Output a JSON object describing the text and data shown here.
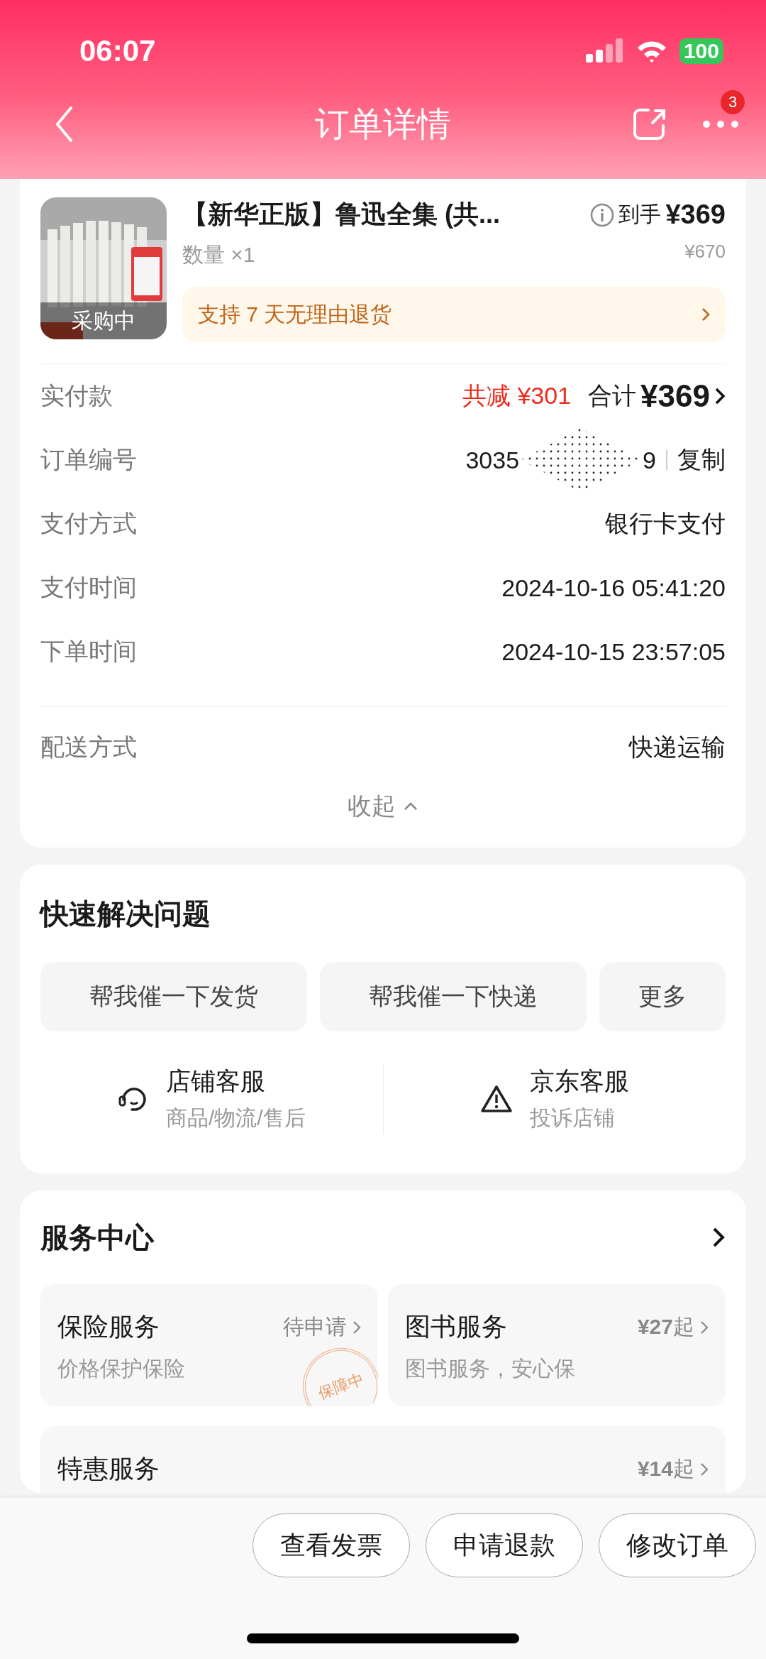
{
  "status_bar": {
    "time": "06:07",
    "battery": "100"
  },
  "nav": {
    "title": "订单详情",
    "badge": "3"
  },
  "product": {
    "title": "【新华正版】鲁迅全集 (共...",
    "image_label": "采购中",
    "final_price_label": "到手",
    "final_price": "¥369",
    "quantity_label": "数量",
    "quantity": "×1",
    "original_price": "¥670",
    "return_policy": "支持 7 天无理由退货"
  },
  "payment": {
    "label": "实付款",
    "discount": "共减 ¥301",
    "total_label": "合计",
    "total": "¥369"
  },
  "details": [
    {
      "label": "订单编号",
      "kind": "order_number",
      "value_start": "3035",
      "value_end": "9",
      "action": "复制"
    },
    {
      "label": "支付方式",
      "kind": "text",
      "value": "银行卡支付"
    },
    {
      "label": "支付时间",
      "kind": "text",
      "value": "2024-10-16 05:41:20"
    },
    {
      "label": "下单时间",
      "kind": "text",
      "value": "2024-10-15 23:57:05"
    }
  ],
  "shipping": {
    "label": "配送方式",
    "value": "快递运输"
  },
  "collapse": "收起",
  "quick_help": {
    "title": "快速解决问题",
    "actions": [
      "帮我催一下发货",
      "帮我催一下快递",
      "更多"
    ],
    "contacts": [
      {
        "kind": "store",
        "title": "店铺客服",
        "subtitle": "商品/物流/售后"
      },
      {
        "kind": "platform",
        "title": "京东客服",
        "subtitle": "投诉店铺"
      }
    ]
  },
  "service_center": {
    "title": "服务中心",
    "services": [
      {
        "title": "保险服务",
        "status": "待申请",
        "description": "价格保护保险",
        "stamp": "保障中"
      },
      {
        "title": "图书服务",
        "status": "**¥27**起",
        "description": "图书服务，安心保"
      },
      {
        "title": "特惠服务",
        "status": "**¥14**起"
      }
    ]
  },
  "bottom_actions": [
    "查看发票",
    "申请退款",
    "修改订单"
  ]
}
